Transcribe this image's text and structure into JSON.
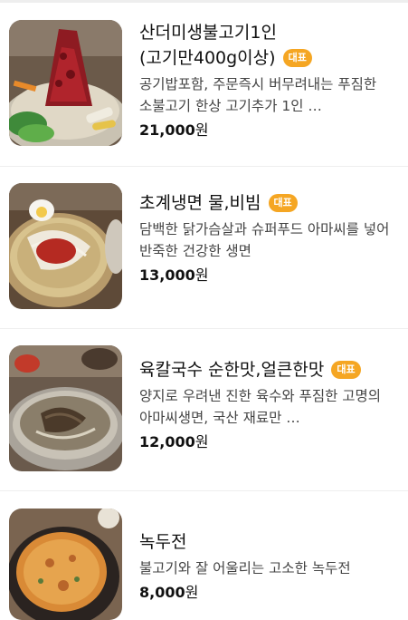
{
  "badge_label": "대표",
  "items": [
    {
      "name": "산더미생불고기1인(고기만400g이상)",
      "has_badge": true,
      "description": "공기밥포함, 주문즉시 버무려내는 푸짐한 소불고기 한상 고기추가 1인 …",
      "price_number": "21,000",
      "price_unit": "원",
      "image_icon": "bulgogi-photo"
    },
    {
      "name": "초계냉면 물,비빔",
      "has_badge": true,
      "description": "담백한 닭가슴살과 슈퍼푸드 아마씨를 넣어 반죽한 건강한 생면",
      "price_number": "13,000",
      "price_unit": "원",
      "image_icon": "naengmyeon-photo"
    },
    {
      "name": "육칼국수 순한맛,얼큰한맛",
      "has_badge": true,
      "description": "양지로 우려낸 진한 육수와 푸짐한 고명의 아마씨생면, 국산 재료만 …",
      "price_number": "12,000",
      "price_unit": "원",
      "image_icon": "kalguksu-photo"
    },
    {
      "name": "녹두전",
      "has_badge": false,
      "description": "불고기와 잘 어울리는 고소한 녹두전",
      "price_number": "8,000",
      "price_unit": "원",
      "image_icon": "nokdujeon-photo"
    }
  ],
  "colors": {
    "badge": "#f5a623",
    "divider": "#eeeeee"
  }
}
